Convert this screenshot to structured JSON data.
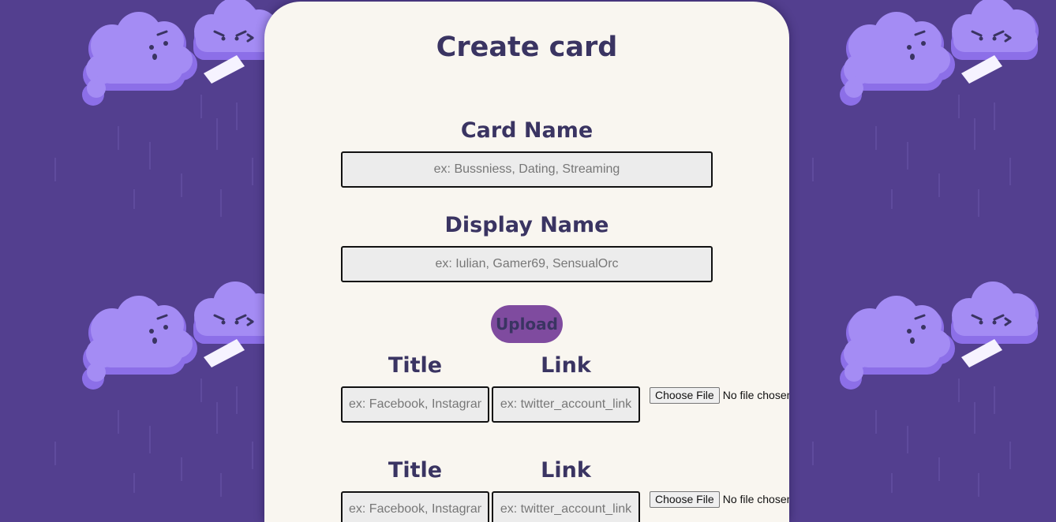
{
  "colors": {
    "background": "#533f8f",
    "card": "#f9f6f0",
    "heading_text": "#3a3462",
    "input_bg": "#ececec",
    "upload_button": "#7f4b9f",
    "cloud": "#a48cf4",
    "cloud_shadow": "#8c6fe8"
  },
  "background": {
    "decoration": "angry-cloud-icon pattern with rain"
  },
  "form": {
    "title": "Create card",
    "card_name": {
      "label": "Card Name",
      "placeholder": "ex: Bussniess, Dating, Streaming",
      "value": ""
    },
    "display_name": {
      "label": "Display Name",
      "placeholder": "ex: Iulian, Gamer69, SensualOrc",
      "value": ""
    },
    "upload_label": "Upload",
    "links": [
      {
        "title_label": "Title",
        "link_label": "Link",
        "title_placeholder": "ex: Facebook, Instagram",
        "link_placeholder": "ex: twitter_account_link",
        "file_button": "Choose File",
        "file_status": "No file chosen"
      },
      {
        "title_label": "Title",
        "link_label": "Link",
        "title_placeholder": "ex: Facebook, Instagram",
        "link_placeholder": "ex: twitter_account_link",
        "file_button": "Choose File",
        "file_status": "No file chosen"
      }
    ]
  }
}
